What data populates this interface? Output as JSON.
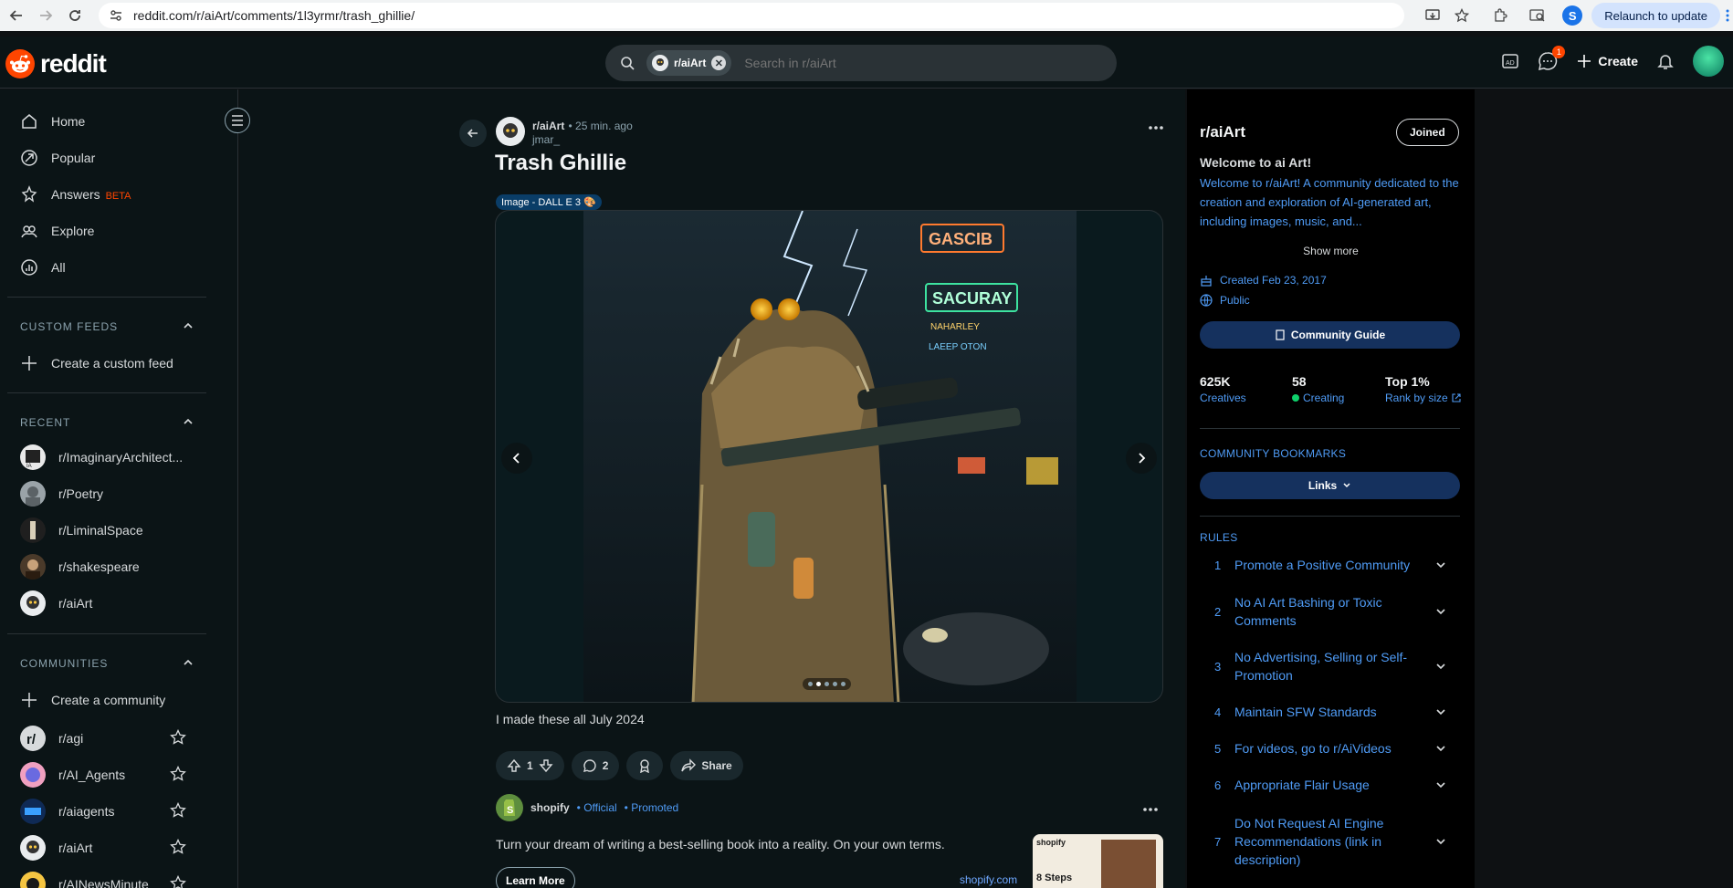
{
  "browser": {
    "url": "reddit.com/r/aiArt/comments/1l3yrmr/trash_ghillie/",
    "profile_initial": "S",
    "relaunch_label": "Relaunch to update"
  },
  "header": {
    "logo_text": "reddit",
    "search_chip": "r/aiArt",
    "search_placeholder": "Search in r/aiArt",
    "chat_badge": "1",
    "create_label": "Create"
  },
  "left_nav": {
    "items": [
      {
        "label": "Home"
      },
      {
        "label": "Popular"
      },
      {
        "label": "Answers",
        "badge": "BETA"
      },
      {
        "label": "Explore"
      },
      {
        "label": "All"
      }
    ],
    "custom_feeds_heading": "CUSTOM FEEDS",
    "create_feed_label": "Create a custom feed",
    "recent_heading": "RECENT",
    "recent": [
      {
        "label": "r/ImaginaryArchitect..."
      },
      {
        "label": "r/Poetry"
      },
      {
        "label": "r/LiminalSpace"
      },
      {
        "label": "r/shakespeare"
      },
      {
        "label": "r/aiArt"
      }
    ],
    "communities_heading": "COMMUNITIES",
    "create_community_label": "Create a community",
    "communities": [
      {
        "label": "r/agi"
      },
      {
        "label": "r/AI_Agents"
      },
      {
        "label": "r/aiagents"
      },
      {
        "label": "r/aiArt"
      },
      {
        "label": "r/AINewsMinute"
      }
    ]
  },
  "post": {
    "subreddit": "r/aiArt",
    "time": "• 25 min. ago",
    "author": "jmar_",
    "title": "Trash Ghillie",
    "flair": "Image - DALL E 3 🎨",
    "body": "I made these all July 2024",
    "votes": "1",
    "comments": "2",
    "share_label": "Share",
    "carousel_total": 5,
    "carousel_active": 2
  },
  "promo": {
    "advertiser": "shopify",
    "official": "• Official",
    "promoted": "• Promoted",
    "text": "Turn your dream of writing a best-selling book into a reality. On your own terms.",
    "cta": "Learn More",
    "domain": "shopify.com",
    "ad_brand": "shopify",
    "ad_headline": "8 Steps"
  },
  "community": {
    "name": "r/aiArt",
    "joined_label": "Joined",
    "welcome": "Welcome to ai Art!",
    "description": "Welcome to r/aiArt! A community dedicated to the creation and exploration of AI-generated art, including images, music, and...",
    "show_more": "Show more",
    "created": "Created Feb 23, 2017",
    "visibility": "Public",
    "guide_label": "Community Guide",
    "stats": [
      {
        "num": "625K",
        "label": "Creatives"
      },
      {
        "num": "58",
        "label": "Creating"
      },
      {
        "num": "Top 1%",
        "label": "Rank by size"
      }
    ],
    "bookmarks_heading": "COMMUNITY BOOKMARKS",
    "links_label": "Links",
    "rules_heading": "RULES",
    "rules": [
      {
        "n": "1",
        "text": "Promote a Positive Community"
      },
      {
        "n": "2",
        "text": "No AI Art Bashing or Toxic Comments"
      },
      {
        "n": "3",
        "text": "No Advertising, Selling or Self-Promotion"
      },
      {
        "n": "4",
        "text": "Maintain SFW Standards"
      },
      {
        "n": "5",
        "text": "For videos, go to r/AiVideos"
      },
      {
        "n": "6",
        "text": "Appropriate Flair Usage"
      },
      {
        "n": "7",
        "text": "Do Not Request AI Engine Recommendations (link in description)"
      }
    ]
  },
  "colors": {
    "accent": "#ff4500",
    "link": "#4f9bf5",
    "background": "#0b1416"
  }
}
